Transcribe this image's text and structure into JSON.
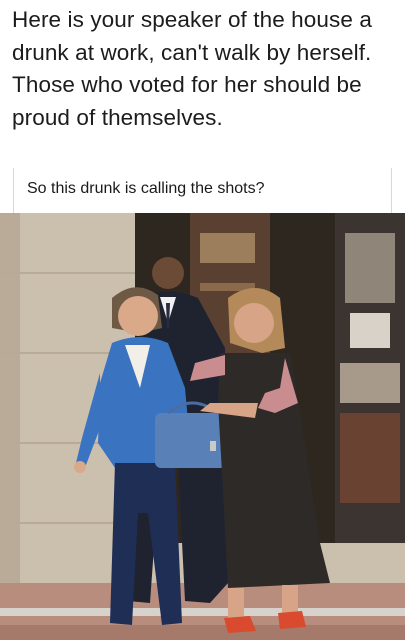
{
  "meme": {
    "headline": "Here is your speaker of the house a drunk at work, can't walk by herself. Those who voted for her should be proud of themselves.",
    "comment": "So this drunk is calling the shots?"
  },
  "photo": {
    "description_icon": "photo-of-three-people-exiting-building",
    "colors": {
      "wall": "#cbbfad",
      "doorway": "#2e2720",
      "sidewalk": "#b98d7e",
      "blue_suit": "#3a73bf",
      "navy_pants": "#1f2e55",
      "bag": "#5a80b8",
      "black_dress": "#2d2a28",
      "floral_sleeve": "#c98d8f"
    }
  }
}
